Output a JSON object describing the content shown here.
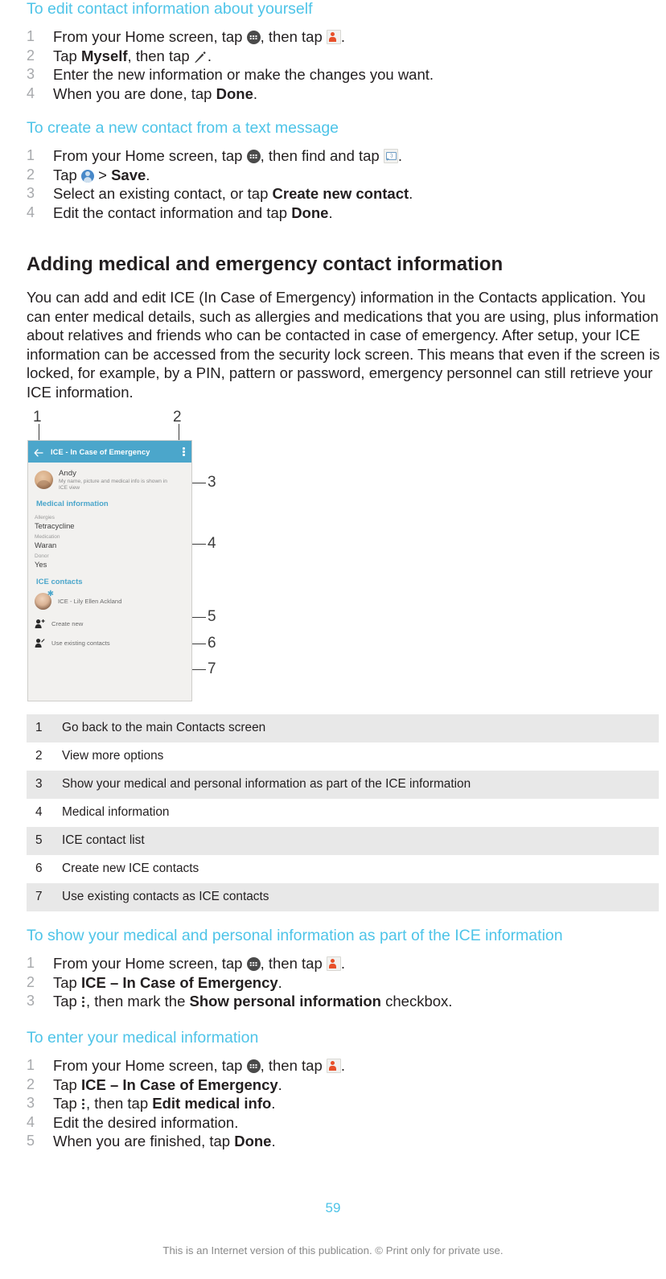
{
  "sections": [
    {
      "heading": "To edit contact information about yourself",
      "steps": [
        {
          "num": "1",
          "pre": "From your Home screen, tap ",
          "mid": ", then tap ",
          "post": "."
        },
        {
          "num": "2",
          "pre": "Tap ",
          "bold": "Myself",
          "mid": ", then tap ",
          "post": "."
        },
        {
          "num": "3",
          "text": "Enter the new information or make the changes you want."
        },
        {
          "num": "4",
          "pre": "When you are done, tap ",
          "bold": "Done",
          "post": "."
        }
      ]
    },
    {
      "heading": "To create a new contact from a text message",
      "steps": [
        {
          "num": "1",
          "pre": "From your Home screen, tap ",
          "mid": ", then find and tap ",
          "post": "."
        },
        {
          "num": "2",
          "pre": "Tap ",
          "mid": " > ",
          "bold": "Save",
          "post": "."
        },
        {
          "num": "3",
          "pre": "Select an existing contact, or tap ",
          "bold": "Create new contact",
          "post": "."
        },
        {
          "num": "4",
          "pre": "Edit the contact information and tap ",
          "bold": "Done",
          "post": "."
        }
      ]
    }
  ],
  "main_heading": "Adding medical and emergency contact information",
  "main_paragraph": "You can add and edit ICE (In Case of Emergency) information in the Contacts application. You can enter medical details, such as allergies and medications that you are using, plus information about relatives and friends who can be contacted in case of emergency. After setup, your ICE information can be accessed from the security lock screen. This means that even if the screen is locked, for example, by a PIN, pattern or password, emergency personnel can still retrieve your ICE information.",
  "illustration": {
    "callouts": [
      "1",
      "2",
      "3",
      "4",
      "5",
      "6",
      "7"
    ],
    "appbar": {
      "title": "ICE - In Case of Emergency",
      "back_icon": "back-arrow-icon",
      "overflow_icon": "overflow-menu-icon",
      "background_color": "#4ba6cb"
    },
    "contact": {
      "name": "Andy",
      "subtitle": "My name, picture and medical info is shown in ICE view"
    },
    "medical_section_label": "Medical information",
    "fields": [
      {
        "label": "Allergies",
        "value": "Tetracycline"
      },
      {
        "label": "Medication",
        "value": "Waran"
      },
      {
        "label": "Donor",
        "value": "Yes"
      }
    ],
    "ice_section_label": "ICE contacts",
    "ice_contact": "ICE - Lily Ellen Ackland",
    "actions": [
      {
        "label": "Create new",
        "icon": "person-add-icon"
      },
      {
        "label": "Use existing contacts",
        "icon": "person-edit-icon"
      }
    ]
  },
  "reference_table": [
    {
      "num": "1",
      "desc": "Go back to the main Contacts screen"
    },
    {
      "num": "2",
      "desc": "View more options"
    },
    {
      "num": "3",
      "desc": "Show your medical and personal information as part of the ICE information"
    },
    {
      "num": "4",
      "desc": "Medical information"
    },
    {
      "num": "5",
      "desc": "ICE contact list"
    },
    {
      "num": "6",
      "desc": "Create new ICE contacts"
    },
    {
      "num": "7",
      "desc": "Use existing contacts as ICE contacts"
    }
  ],
  "sections2": [
    {
      "heading": "To show your medical and personal information as part of the ICE information",
      "steps": [
        {
          "num": "1",
          "pre": "From your Home screen, tap ",
          "mid": ", then tap ",
          "post": "."
        },
        {
          "num": "2",
          "pre": "Tap ",
          "bold": "ICE – In Case of Emergency",
          "post": "."
        },
        {
          "num": "3",
          "pre": "Tap ",
          "mid": ", then mark the ",
          "bold": "Show personal information",
          "post": " checkbox."
        }
      ]
    },
    {
      "heading": "To enter your medical information",
      "steps": [
        {
          "num": "1",
          "pre": "From your Home screen, tap ",
          "mid": ", then tap ",
          "post": "."
        },
        {
          "num": "2",
          "pre": "Tap ",
          "bold": "ICE – In Case of Emergency",
          "post": "."
        },
        {
          "num": "3",
          "pre": "Tap ",
          "mid": ", then tap ",
          "bold": "Edit medical info",
          "post": "."
        },
        {
          "num": "4",
          "text": "Edit the desired information."
        },
        {
          "num": "5",
          "pre": "When you are finished, tap ",
          "bold": "Done",
          "post": "."
        }
      ]
    }
  ],
  "page_number": "59",
  "footer_note": "This is an Internet version of this publication. © Print only for private use.",
  "colors": {
    "heading_blue": "#4ec4e8",
    "appbar_teal": "#4ba6cb",
    "table_shade": "#e8e8e8",
    "step_number_gray": "#a7a9ac"
  }
}
